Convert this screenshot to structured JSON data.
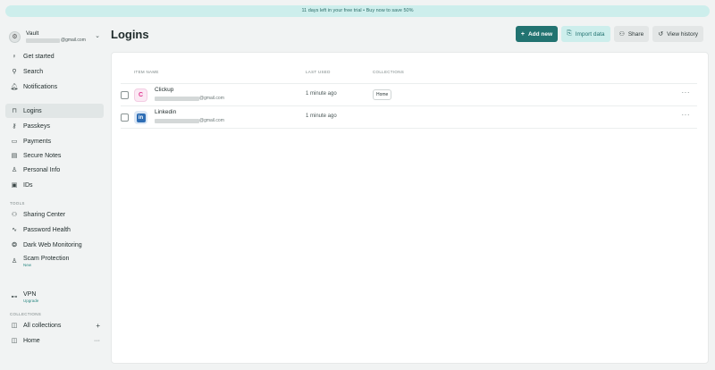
{
  "banner": {
    "text": "11 days left in your free trial • Buy now to save 50%"
  },
  "vault": {
    "name": "Vault",
    "email_suffix": "@gmail.com",
    "avatar_icon": "gear-icon",
    "caret_icon": "chevron-down-icon"
  },
  "nav": {
    "get_started": "Get started",
    "search": "Search",
    "notifications": "Notifications",
    "logins": "Logins",
    "passkeys": "Passkeys",
    "payments": "Payments",
    "secure_notes": "Secure Notes",
    "personal_info": "Personal Info",
    "ids": "IDs"
  },
  "tools": {
    "label": "TOOLS",
    "sharing_center": "Sharing Center",
    "password_health": "Password Health",
    "dark_web": "Dark Web Monitoring",
    "scam_protection": "Scam Protection",
    "scam_badge": "New",
    "vpn": "VPN",
    "vpn_badge": "Upgrade"
  },
  "collections": {
    "label": "COLLECTIONS",
    "all": "All collections",
    "home": "Home"
  },
  "header": {
    "title": "Logins",
    "add_new": "Add new",
    "import": "Import data",
    "share": "Share",
    "history": "View history"
  },
  "table": {
    "col_name": "ITEM NAME",
    "col_used": "LAST USED",
    "col_collections": "COLLECTIONS",
    "rows": [
      {
        "name": "Clickup",
        "email_suffix": "@gmail.com",
        "last_used": "1 minute ago",
        "collection": "Home",
        "logo_icon": "clickup-logo-icon"
      },
      {
        "name": "Linkedin",
        "email_suffix": "@gmail.com",
        "last_used": "1 minute ago",
        "collection": "",
        "logo_icon": "linkedin-logo-icon"
      }
    ]
  },
  "colors": {
    "accent": "#227371",
    "accent_light": "#cdeeec",
    "background": "#f1f3f3"
  }
}
